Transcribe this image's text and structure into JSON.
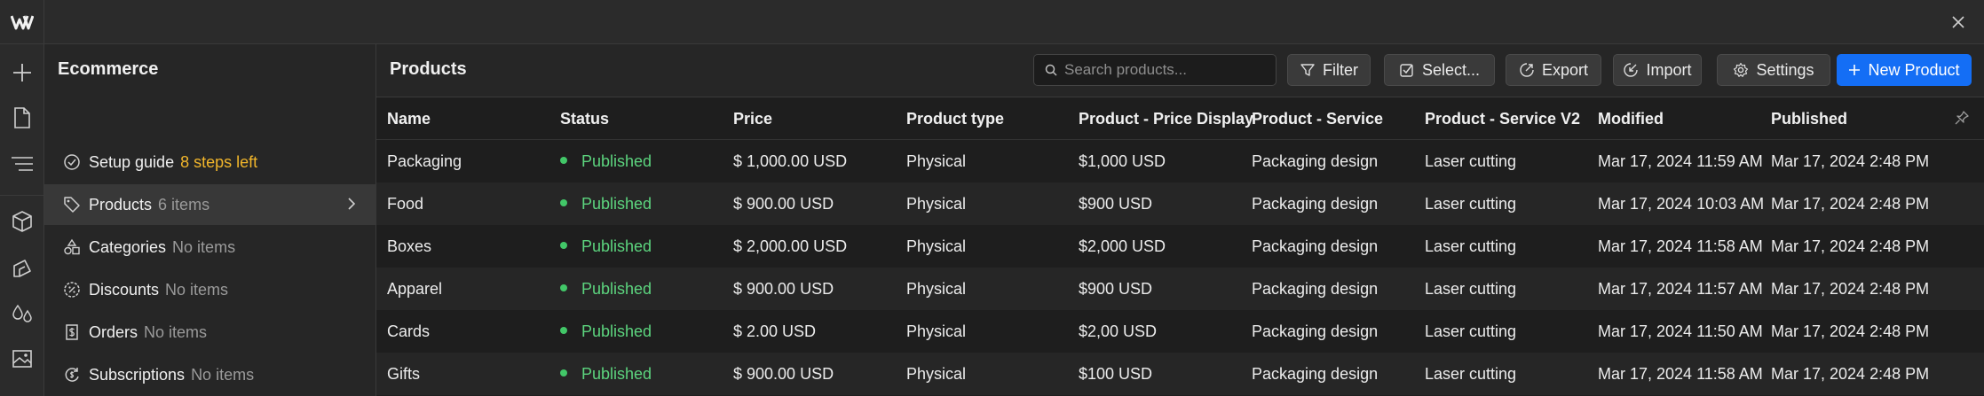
{
  "sidebar": {
    "title": "Ecommerce",
    "items": [
      {
        "label": "Setup guide",
        "count": "8 steps left"
      },
      {
        "label": "Products",
        "count": "6 items"
      },
      {
        "label": "Categories",
        "count": "No items"
      },
      {
        "label": "Discounts",
        "count": "No items"
      },
      {
        "label": "Orders",
        "count": "No items"
      },
      {
        "label": "Subscriptions",
        "count": "No items"
      }
    ]
  },
  "main": {
    "title": "Products",
    "search_placeholder": "Search products...",
    "buttons": {
      "filter": "Filter",
      "select": "Select...",
      "export": "Export",
      "import": "Import",
      "settings": "Settings",
      "new_product": "New Product"
    }
  },
  "table": {
    "columns": [
      "Name",
      "Status",
      "Price",
      "Product type",
      "Product - Price Display",
      "Product - Service",
      "Product - Service V2",
      "Modified",
      "Published"
    ],
    "rows": [
      {
        "name": "Packaging",
        "status": "Published",
        "price": "$ 1,000.00 USD",
        "type": "Physical",
        "price_display": "$1,000 USD",
        "service": "Packaging design",
        "service_v2": "Laser cutting",
        "modified": "Mar 17, 2024 11:59 AM",
        "published": "Mar 17, 2024 2:48 PM"
      },
      {
        "name": "Food",
        "status": "Published",
        "price": "$ 900.00 USD",
        "type": "Physical",
        "price_display": "$900 USD",
        "service": "Packaging design",
        "service_v2": "Laser cutting",
        "modified": "Mar 17, 2024 10:03 AM",
        "published": "Mar 17, 2024 2:48 PM"
      },
      {
        "name": "Boxes",
        "status": "Published",
        "price": "$ 2,000.00 USD",
        "type": "Physical",
        "price_display": "$2,000 USD",
        "service": "Packaging design",
        "service_v2": "Laser cutting",
        "modified": "Mar 17, 2024 11:58 AM",
        "published": "Mar 17, 2024 2:48 PM"
      },
      {
        "name": "Apparel",
        "status": "Published",
        "price": "$ 900.00 USD",
        "type": "Physical",
        "price_display": "$900 USD",
        "service": "Packaging design",
        "service_v2": "Laser cutting",
        "modified": "Mar 17, 2024 11:57 AM",
        "published": "Mar 17, 2024 2:48 PM"
      },
      {
        "name": "Cards",
        "status": "Published",
        "price": "$ 2.00 USD",
        "type": "Physical",
        "price_display": "$2,00 USD",
        "service": "Packaging design",
        "service_v2": "Laser cutting",
        "modified": "Mar 17, 2024 11:50 AM",
        "published": "Mar 17, 2024 2:48 PM"
      },
      {
        "name": "Gifts",
        "status": "Published",
        "price": "$ 900.00 USD",
        "type": "Physical",
        "price_display": "$100 USD",
        "service": "Packaging design",
        "service_v2": "Laser cutting",
        "modified": "Mar 17, 2024 11:58 AM",
        "published": "Mar 17, 2024 2:48 PM"
      }
    ]
  },
  "colors": {
    "accent": "#146ef5",
    "status_published": "#5cd47e",
    "warning": "#f2b62b"
  },
  "icons": {
    "rail": [
      "plus-icon",
      "page-icon",
      "navigator-icon",
      "cube-icon",
      "style-icon",
      "drops-icon",
      "image-icon"
    ],
    "toolbar": [
      "search-icon",
      "filter-icon",
      "checkbox-icon",
      "export-icon",
      "import-icon",
      "gear-icon",
      "plus-icon"
    ]
  }
}
